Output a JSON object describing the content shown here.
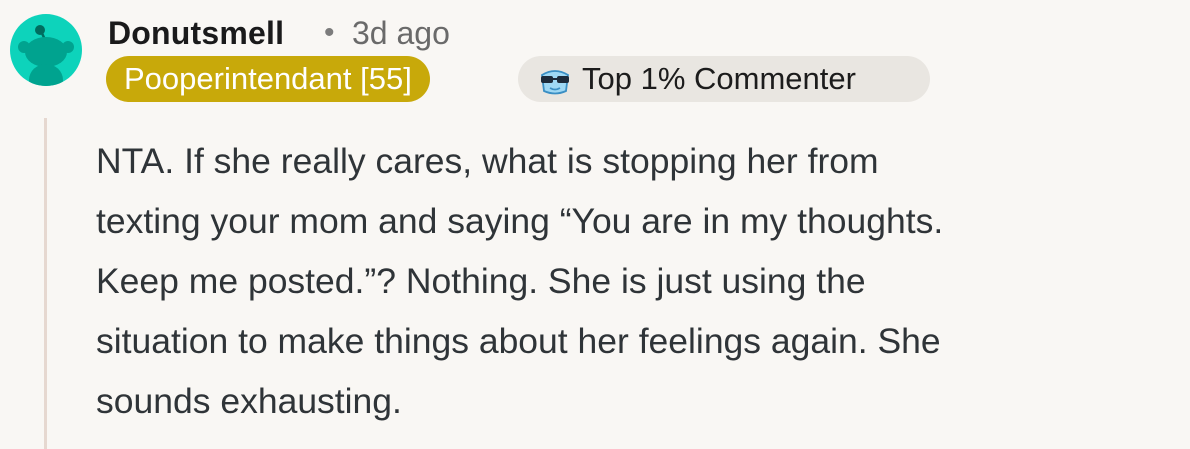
{
  "comment": {
    "username": "Donutsmell",
    "separator": "•",
    "timestamp": "3d ago",
    "flair": "Pooperintendant [55]",
    "badge": "Top 1% Commenter",
    "body_lines": [
      "NTA.  If she really cares, what is stopping her from",
      "texting your mom and saying “You are in my thoughts.",
      "Keep me posted.”?  Nothing. She is just using the",
      "situation to make things about her feelings again. She",
      "sounds exhausting."
    ]
  },
  "colors": {
    "avatar_bg": "#0dd3bb",
    "flair_bg": "#c8a90a",
    "badge_bg": "#e9e6e1",
    "thread_line": "#e6d8d0"
  },
  "icons": {
    "avatar": "reddit-snoo-avatar",
    "badge": "sunglasses-commenter-icon"
  }
}
